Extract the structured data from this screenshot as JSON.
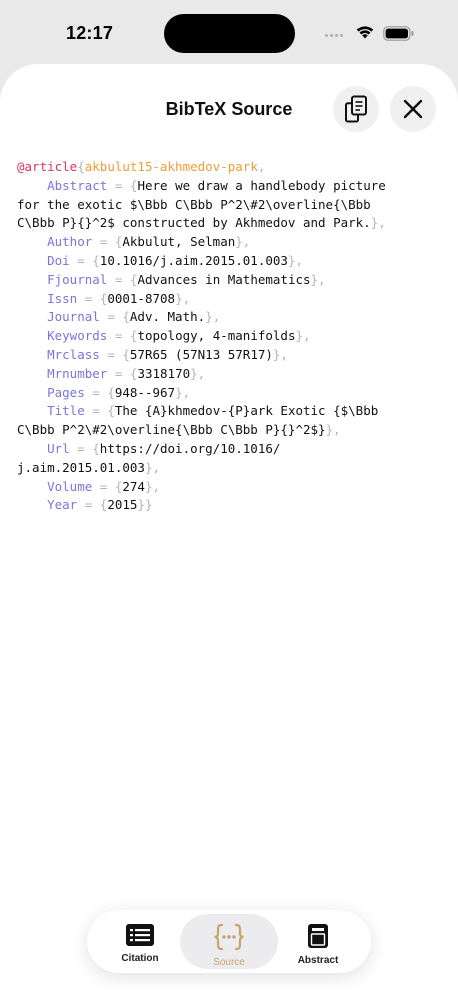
{
  "status": {
    "time": "12:17"
  },
  "sheet": {
    "title": "BibTeX Source"
  },
  "bibtex": {
    "entry_type": "@article",
    "open_brace": "{",
    "cite_key": "akbulut15-akhmedov-park",
    "lines": [
      {
        "indent": "    ",
        "field": "Abstract",
        "sep": " = {",
        "value": "Here we draw a handlebody picture\nfor the exotic $\\Bbb C\\Bbb P^2\\#2\\overline{\\Bbb\nC\\Bbb P}{}^2$ constructed by Akhmedov and Park.",
        "end": "},"
      },
      {
        "indent": "    ",
        "field": "Author",
        "sep": " = {",
        "value": "Akbulut, Selman",
        "end": "},"
      },
      {
        "indent": "    ",
        "field": "Doi",
        "sep": " = {",
        "value": "10.1016/j.aim.2015.01.003",
        "end": "},"
      },
      {
        "indent": "    ",
        "field": "Fjournal",
        "sep": " = {",
        "value": "Advances in Mathematics",
        "end": "},"
      },
      {
        "indent": "    ",
        "field": "Issn",
        "sep": " = {",
        "value": "0001-8708",
        "end": "},"
      },
      {
        "indent": "    ",
        "field": "Journal",
        "sep": " = {",
        "value": "Adv. Math.",
        "end": "},"
      },
      {
        "indent": "    ",
        "field": "Keywords",
        "sep": " = {",
        "value": "topology, 4-manifolds",
        "end": "},"
      },
      {
        "indent": "    ",
        "field": "Mrclass",
        "sep": " = {",
        "value": "57R65 (57N13 57R17)",
        "end": "},"
      },
      {
        "indent": "    ",
        "field": "Mrnumber",
        "sep": " = {",
        "value": "3318170",
        "end": "},"
      },
      {
        "indent": "    ",
        "field": "Pages",
        "sep": " = {",
        "value": "948--967",
        "end": "},"
      },
      {
        "indent": "    ",
        "field": "Title",
        "sep": " = {",
        "value": "The {A}khmedov-{P}ark Exotic {$\\Bbb\nC\\Bbb P^2\\#2\\overline{\\Bbb C\\Bbb P}{}^2$}",
        "end": "},"
      },
      {
        "indent": "    ",
        "field": "Url",
        "sep": " = {",
        "value": "https://doi.org/10.1016/\nj.aim.2015.01.003",
        "end": "},"
      },
      {
        "indent": "    ",
        "field": "Volume",
        "sep": " = {",
        "value": "274",
        "end": "},"
      },
      {
        "indent": "    ",
        "field": "Year",
        "sep": " = {",
        "value": "2015",
        "end": "}}"
      }
    ]
  },
  "tabs": [
    {
      "label": "Citation",
      "icon": "citation-icon",
      "selected": false
    },
    {
      "label": "Source",
      "icon": "source-braces-icon",
      "selected": true
    },
    {
      "label": "Abstract",
      "icon": "abstract-icon",
      "selected": false
    }
  ],
  "colors": {
    "entry_type": "#e0345e",
    "cite_key": "#f19c38",
    "field_name": "#7a75d9",
    "punctuation": "#b4b4b8",
    "tab_selected": "#c9a26a"
  }
}
